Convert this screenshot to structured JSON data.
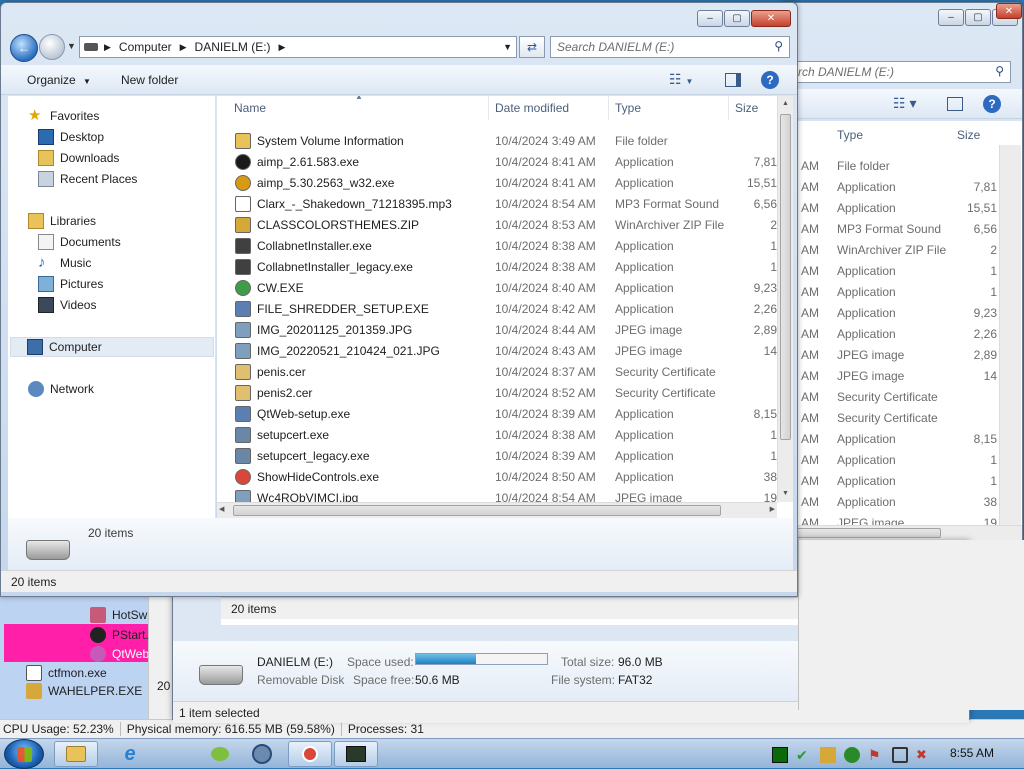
{
  "front": {
    "breadcrumb": [
      "Computer",
      "DANIELM (E:)"
    ],
    "search_placeholder": "Search DANIELM (E:)",
    "organize": "Organize",
    "new_folder": "New folder",
    "nav": {
      "favorites": "Favorites",
      "desktop": "Desktop",
      "downloads": "Downloads",
      "recent": "Recent Places",
      "libraries": "Libraries",
      "documents": "Documents",
      "music": "Music",
      "pictures": "Pictures",
      "videos": "Videos",
      "computer": "Computer",
      "network": "Network"
    },
    "columns": {
      "name": "Name",
      "date": "Date modified",
      "type": "Type",
      "size": "Size"
    },
    "files": [
      {
        "name": "System Volume Information",
        "date": "10/4/2024 3:49 AM",
        "type": "File folder",
        "size": "",
        "icon": "folder-icon",
        "color": "#e8c35a"
      },
      {
        "name": "aimp_2.61.583.exe",
        "date": "10/4/2024 8:41 AM",
        "type": "Application",
        "size": "7,81",
        "icon": "aimp-icon",
        "color": "#1a1a1a"
      },
      {
        "name": "aimp_5.30.2563_w32.exe",
        "date": "10/4/2024 8:41 AM",
        "type": "Application",
        "size": "15,51",
        "icon": "aimp-icon",
        "color": "#d89a12"
      },
      {
        "name": "Clarx_-_Shakedown_71218395.mp3",
        "date": "10/4/2024 8:54 AM",
        "type": "MP3 Format Sound",
        "size": "6,56",
        "icon": "audio-file-icon",
        "color": "#ffffff"
      },
      {
        "name": "CLASSCOLORSTHEMES.ZIP",
        "date": "10/4/2024 8:53 AM",
        "type": "WinArchiver ZIP File",
        "size": "2",
        "icon": "archive-icon",
        "color": "#d6a83a"
      },
      {
        "name": "CollabnetInstaller.exe",
        "date": "10/4/2024 8:38 AM",
        "type": "Application",
        "size": "1",
        "icon": "installer-icon",
        "color": "#404040"
      },
      {
        "name": "CollabnetInstaller_legacy.exe",
        "date": "10/4/2024 8:38 AM",
        "type": "Application",
        "size": "1",
        "icon": "installer-icon",
        "color": "#404040"
      },
      {
        "name": "CW.EXE",
        "date": "10/4/2024 8:40 AM",
        "type": "Application",
        "size": "9,23",
        "icon": "globe-icon",
        "color": "#3f9d4a"
      },
      {
        "name": "FILE_SHREDDER_SETUP.EXE",
        "date": "10/4/2024 8:42 AM",
        "type": "Application",
        "size": "2,26",
        "icon": "setup-icon",
        "color": "#5a7fb0"
      },
      {
        "name": "IMG_20201125_201359.JPG",
        "date": "10/4/2024 8:44 AM",
        "type": "JPEG image",
        "size": "2,89",
        "icon": "image-icon",
        "color": "#7f9fbf"
      },
      {
        "name": "IMG_20220521_210424_021.JPG",
        "date": "10/4/2024 8:43 AM",
        "type": "JPEG image",
        "size": "14",
        "icon": "image-icon",
        "color": "#7f9fbf"
      },
      {
        "name": "penis.cer",
        "date": "10/4/2024 8:37 AM",
        "type": "Security Certificate",
        "size": "",
        "icon": "certificate-icon",
        "color": "#e0c070"
      },
      {
        "name": "penis2.cer",
        "date": "10/4/2024 8:52 AM",
        "type": "Security Certificate",
        "size": "",
        "icon": "certificate-icon",
        "color": "#e0c070"
      },
      {
        "name": "QtWeb-setup.exe",
        "date": "10/4/2024 8:39 AM",
        "type": "Application",
        "size": "8,15",
        "icon": "setup-icon",
        "color": "#5a7fb0"
      },
      {
        "name": "setupcert.exe",
        "date": "10/4/2024 8:38 AM",
        "type": "Application",
        "size": "1",
        "icon": "app-icon",
        "color": "#6b87a8"
      },
      {
        "name": "setupcert_legacy.exe",
        "date": "10/4/2024 8:39 AM",
        "type": "Application",
        "size": "1",
        "icon": "app-icon",
        "color": "#6b87a8"
      },
      {
        "name": "ShowHideControls.exe",
        "date": "10/4/2024 8:50 AM",
        "type": "Application",
        "size": "38",
        "icon": "toggle-app-icon",
        "color": "#d9473a"
      },
      {
        "name": "Wc4RObVIMCI.jpg",
        "date": "10/4/2024 8:54 AM",
        "type": "JPEG image",
        "size": "19",
        "icon": "image-icon",
        "color": "#7f9fbf"
      }
    ],
    "details_count": "20 items",
    "status": "20 items"
  },
  "back": {
    "search_placeholder": "rch DANIELM (E:)",
    "type_header": "Type",
    "size_header": "Size",
    "rows": [
      {
        "am": "AM",
        "type": "File folder",
        "size": ""
      },
      {
        "am": "AM",
        "type": "Application",
        "size": "7,81"
      },
      {
        "am": "AM",
        "type": "Application",
        "size": "15,51"
      },
      {
        "am": "AM",
        "type": "MP3 Format Sound",
        "size": "6,56"
      },
      {
        "am": "AM",
        "type": "WinArchiver ZIP File",
        "size": "2"
      },
      {
        "am": "AM",
        "type": "Application",
        "size": "1"
      },
      {
        "am": "AM",
        "type": "Application",
        "size": "1"
      },
      {
        "am": "AM",
        "type": "Application",
        "size": "9,23"
      },
      {
        "am": "AM",
        "type": "Application",
        "size": "2,26"
      },
      {
        "am": "AM",
        "type": "JPEG image",
        "size": "2,89"
      },
      {
        "am": "AM",
        "type": "JPEG image",
        "size": "14"
      },
      {
        "am": "AM",
        "type": "Security Certificate",
        "size": ""
      },
      {
        "am": "AM",
        "type": "Security Certificate",
        "size": ""
      },
      {
        "am": "AM",
        "type": "Application",
        "size": "8,15"
      },
      {
        "am": "AM",
        "type": "Application",
        "size": "1"
      },
      {
        "am": "AM",
        "type": "Application",
        "size": "1"
      },
      {
        "am": "AM",
        "type": "Application",
        "size": "38"
      },
      {
        "am": "AM",
        "type": "JPEG image",
        "size": "19"
      }
    ]
  },
  "third": {
    "items_count": "20 items",
    "drive_name": "DANIELM (E:)",
    "drive_kind": "Removable Disk",
    "space_used_label": "Space used:",
    "space_used_fraction": 0.46,
    "space_free_label": "Space free:",
    "space_free": "50.6 MB",
    "total_label": "Total size:",
    "total": "96.0 MB",
    "fs_label": "File system:",
    "fs": "FAT32",
    "status": "1 item selected",
    "left_num": "20"
  },
  "taskmgr": {
    "procs": [
      {
        "name": "HotSw",
        "bg": "#bcd3f2"
      },
      {
        "name": "PStart.",
        "bg": "#ff1fa8"
      },
      {
        "name": "QtWeb",
        "bg": "#ff1fa8"
      },
      {
        "name": "ctfmon.exe",
        "bg": "#bcd3f2"
      },
      {
        "name": "WAHELPER.EXE",
        "bg": "#bcd3f2"
      }
    ],
    "status_cpu": "CPU Usage: 52.23%",
    "status_mem": "Physical memory: 616.55 MB (59.58%)",
    "status_proc": "Processes: 31"
  },
  "taskbar": {
    "clock": "8:55 AM"
  }
}
